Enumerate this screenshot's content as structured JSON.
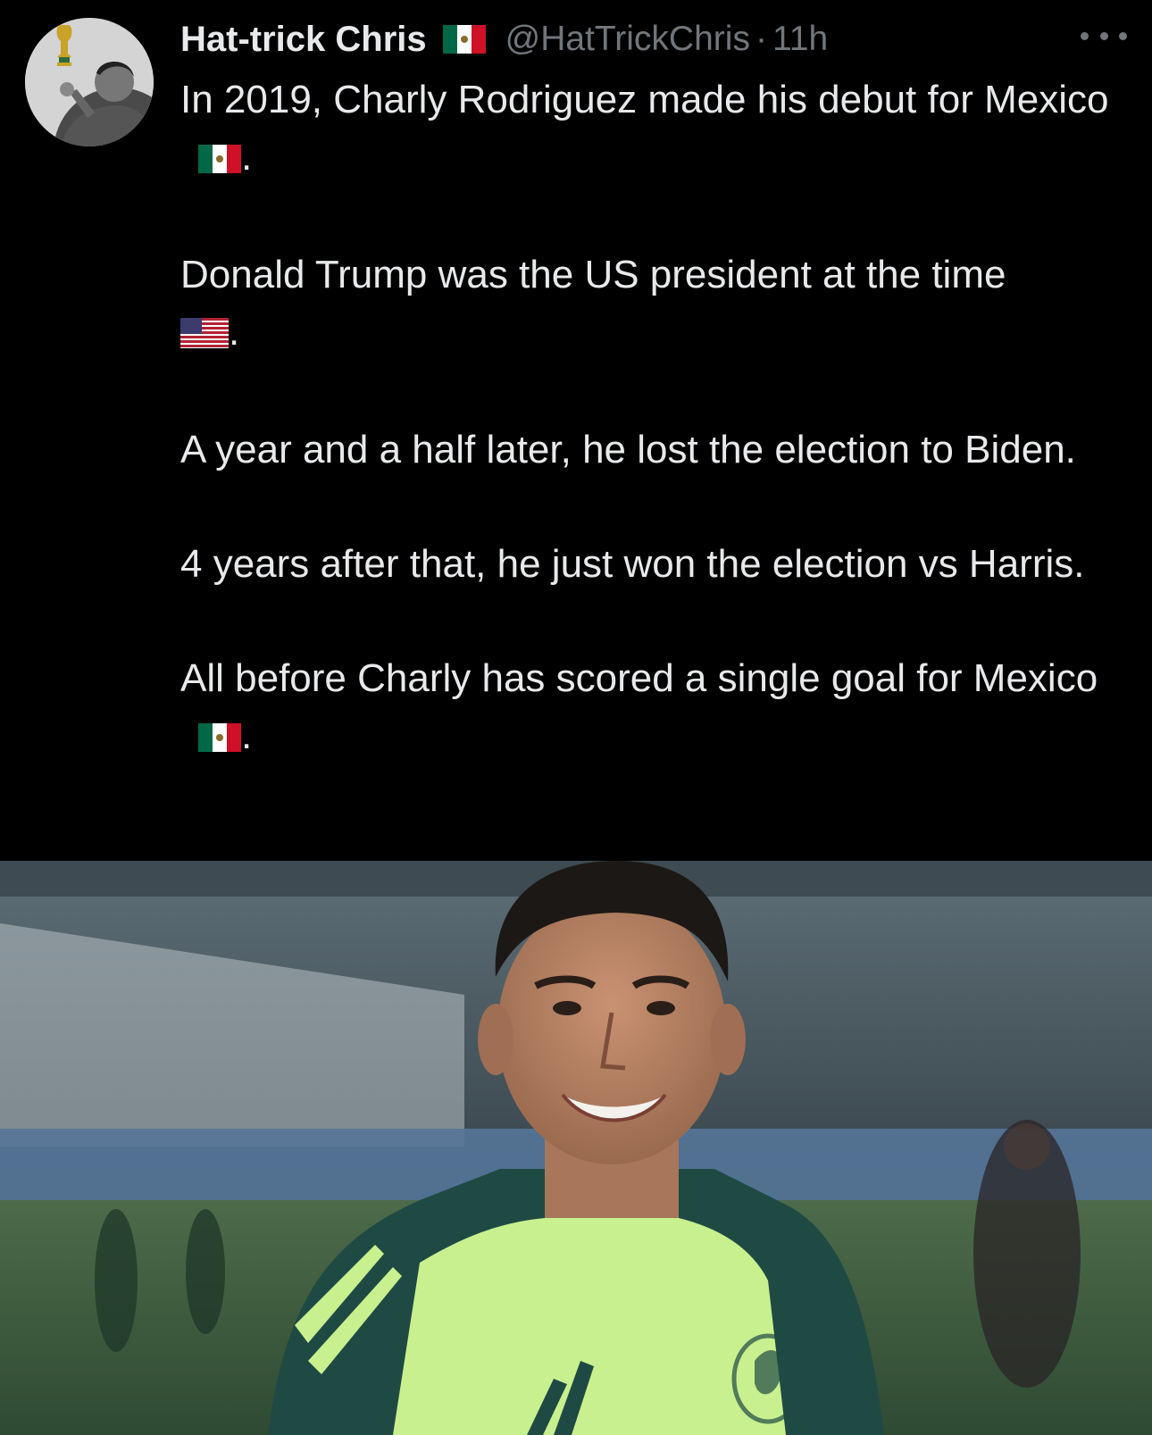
{
  "tweet": {
    "author": {
      "display_name": "Hat-trick Chris",
      "handle": "@HatTrickChris",
      "time": "11h",
      "separator": "·",
      "flag_icon": "mexico-flag-icon"
    },
    "paragraphs": [
      {
        "text": "In 2019, Charly Rodriguez made his debut for Mexico",
        "trail_flag": "mexico",
        "trail_punct": "."
      },
      {
        "text": "Donald Trump was the US president at the time",
        "trail_flag": "usa",
        "trail_punct": "."
      },
      {
        "text": "A year and a half later, he lost the election to Biden.",
        "trail_flag": null,
        "trail_punct": ""
      },
      {
        "text": "4 years after that, he just won the election vs Harris.",
        "trail_flag": null,
        "trail_punct": ""
      },
      {
        "text": "All before Charly has scored a single goal for Mexico",
        "trail_flag": "mexico",
        "trail_punct": "."
      }
    ],
    "more_icon": "more-options-icon"
  },
  "colors": {
    "background": "#000000",
    "text": "#e7e9ea",
    "muted": "#71767b",
    "jersey_green": "#c9f08f",
    "jersey_dark": "#1f4a44"
  }
}
